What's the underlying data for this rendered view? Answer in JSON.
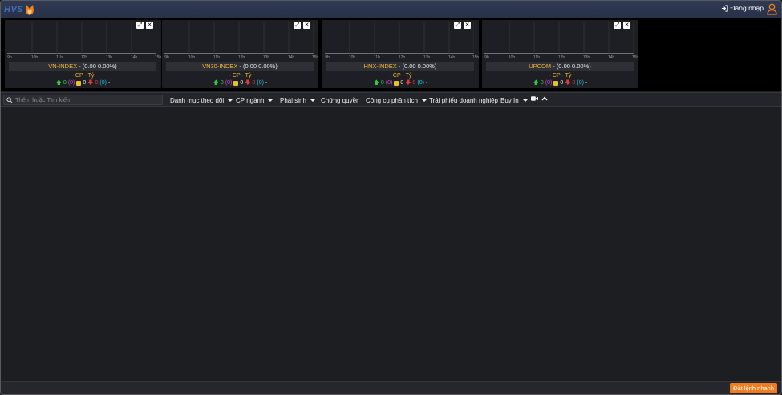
{
  "header": {
    "logo_text": "HVS",
    "login_label": "Đăng nhập"
  },
  "time_ticks": [
    "9h",
    "10h",
    "11h",
    "12h",
    "13h",
    "14h",
    "15h"
  ],
  "cards": [
    {
      "name": "VN-INDEX",
      "value": "(0.00 0.00%)",
      "line2": "- CP - Tỷ",
      "up": "0",
      "ref_count": "(0)",
      "ref": "0",
      "down": "0",
      "total": "(0)",
      "tail": "-"
    },
    {
      "name": "VN30-INDEX",
      "value": "(0.00 0.00%)",
      "line2": "- CP - Tỷ",
      "up": "0",
      "ref_count": "(0)",
      "ref": "0",
      "down": "0",
      "total": "(0)",
      "tail": "-"
    },
    {
      "name": "HNX-INDEX",
      "value": "(0.00 0.00%)",
      "line2": "- CP - Tỷ",
      "up": "0",
      "ref_count": "(0)",
      "ref": "0",
      "down": "0",
      "total": "(0)",
      "tail": "-"
    },
    {
      "name": "UPCOM",
      "value": "(0.00 0.00%)",
      "line2": "- CP - Tỷ",
      "up": "0",
      "ref_count": "(0)",
      "ref": "0",
      "down": "0",
      "total": "(0)",
      "tail": "-"
    }
  ],
  "toolbar": {
    "search_placeholder": "Thêm hoặc Tìm kiếm",
    "menus": [
      {
        "label": "Danh mục theo dõi",
        "dropdown": true
      },
      {
        "label": "CP ngành",
        "dropdown": true
      },
      {
        "label": "Phái sinh",
        "dropdown": true
      },
      {
        "label": "Chứng quyền",
        "dropdown": false
      },
      {
        "label": "Công cụ phân tích",
        "dropdown": true
      },
      {
        "label": "Trái phiếu doanh nghiệp",
        "dropdown": false
      },
      {
        "label": "Buy In",
        "dropdown": true
      }
    ]
  },
  "footer": {
    "order_button": "Đặt lệnh nhanh"
  },
  "colors": {
    "header_bg": "#2f3b52",
    "accent_orange": "#f07c1e",
    "index_name": "#f0b43c",
    "up": "#2ecc40",
    "down": "#e03a3a",
    "ref": "#e6c229"
  }
}
